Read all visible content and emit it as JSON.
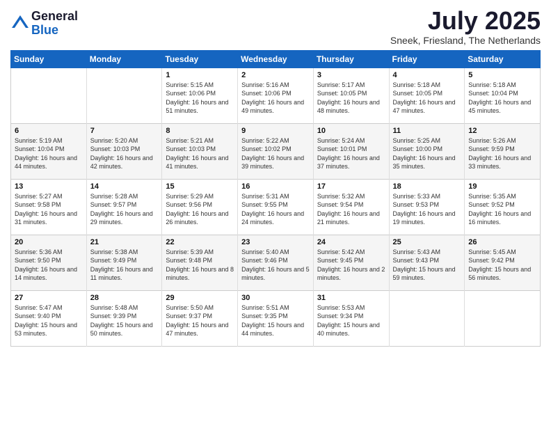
{
  "header": {
    "logo_general": "General",
    "logo_blue": "Blue",
    "month_title": "July 2025",
    "location": "Sneek, Friesland, The Netherlands"
  },
  "days_of_week": [
    "Sunday",
    "Monday",
    "Tuesday",
    "Wednesday",
    "Thursday",
    "Friday",
    "Saturday"
  ],
  "weeks": [
    [
      {
        "num": "",
        "content": ""
      },
      {
        "num": "",
        "content": ""
      },
      {
        "num": "1",
        "content": "Sunrise: 5:15 AM\nSunset: 10:06 PM\nDaylight: 16 hours and 51 minutes."
      },
      {
        "num": "2",
        "content": "Sunrise: 5:16 AM\nSunset: 10:06 PM\nDaylight: 16 hours and 49 minutes."
      },
      {
        "num": "3",
        "content": "Sunrise: 5:17 AM\nSunset: 10:05 PM\nDaylight: 16 hours and 48 minutes."
      },
      {
        "num": "4",
        "content": "Sunrise: 5:18 AM\nSunset: 10:05 PM\nDaylight: 16 hours and 47 minutes."
      },
      {
        "num": "5",
        "content": "Sunrise: 5:18 AM\nSunset: 10:04 PM\nDaylight: 16 hours and 45 minutes."
      }
    ],
    [
      {
        "num": "6",
        "content": "Sunrise: 5:19 AM\nSunset: 10:04 PM\nDaylight: 16 hours and 44 minutes."
      },
      {
        "num": "7",
        "content": "Sunrise: 5:20 AM\nSunset: 10:03 PM\nDaylight: 16 hours and 42 minutes."
      },
      {
        "num": "8",
        "content": "Sunrise: 5:21 AM\nSunset: 10:03 PM\nDaylight: 16 hours and 41 minutes."
      },
      {
        "num": "9",
        "content": "Sunrise: 5:22 AM\nSunset: 10:02 PM\nDaylight: 16 hours and 39 minutes."
      },
      {
        "num": "10",
        "content": "Sunrise: 5:24 AM\nSunset: 10:01 PM\nDaylight: 16 hours and 37 minutes."
      },
      {
        "num": "11",
        "content": "Sunrise: 5:25 AM\nSunset: 10:00 PM\nDaylight: 16 hours and 35 minutes."
      },
      {
        "num": "12",
        "content": "Sunrise: 5:26 AM\nSunset: 9:59 PM\nDaylight: 16 hours and 33 minutes."
      }
    ],
    [
      {
        "num": "13",
        "content": "Sunrise: 5:27 AM\nSunset: 9:58 PM\nDaylight: 16 hours and 31 minutes."
      },
      {
        "num": "14",
        "content": "Sunrise: 5:28 AM\nSunset: 9:57 PM\nDaylight: 16 hours and 29 minutes."
      },
      {
        "num": "15",
        "content": "Sunrise: 5:29 AM\nSunset: 9:56 PM\nDaylight: 16 hours and 26 minutes."
      },
      {
        "num": "16",
        "content": "Sunrise: 5:31 AM\nSunset: 9:55 PM\nDaylight: 16 hours and 24 minutes."
      },
      {
        "num": "17",
        "content": "Sunrise: 5:32 AM\nSunset: 9:54 PM\nDaylight: 16 hours and 21 minutes."
      },
      {
        "num": "18",
        "content": "Sunrise: 5:33 AM\nSunset: 9:53 PM\nDaylight: 16 hours and 19 minutes."
      },
      {
        "num": "19",
        "content": "Sunrise: 5:35 AM\nSunset: 9:52 PM\nDaylight: 16 hours and 16 minutes."
      }
    ],
    [
      {
        "num": "20",
        "content": "Sunrise: 5:36 AM\nSunset: 9:50 PM\nDaylight: 16 hours and 14 minutes."
      },
      {
        "num": "21",
        "content": "Sunrise: 5:38 AM\nSunset: 9:49 PM\nDaylight: 16 hours and 11 minutes."
      },
      {
        "num": "22",
        "content": "Sunrise: 5:39 AM\nSunset: 9:48 PM\nDaylight: 16 hours and 8 minutes."
      },
      {
        "num": "23",
        "content": "Sunrise: 5:40 AM\nSunset: 9:46 PM\nDaylight: 16 hours and 5 minutes."
      },
      {
        "num": "24",
        "content": "Sunrise: 5:42 AM\nSunset: 9:45 PM\nDaylight: 16 hours and 2 minutes."
      },
      {
        "num": "25",
        "content": "Sunrise: 5:43 AM\nSunset: 9:43 PM\nDaylight: 15 hours and 59 minutes."
      },
      {
        "num": "26",
        "content": "Sunrise: 5:45 AM\nSunset: 9:42 PM\nDaylight: 15 hours and 56 minutes."
      }
    ],
    [
      {
        "num": "27",
        "content": "Sunrise: 5:47 AM\nSunset: 9:40 PM\nDaylight: 15 hours and 53 minutes."
      },
      {
        "num": "28",
        "content": "Sunrise: 5:48 AM\nSunset: 9:39 PM\nDaylight: 15 hours and 50 minutes."
      },
      {
        "num": "29",
        "content": "Sunrise: 5:50 AM\nSunset: 9:37 PM\nDaylight: 15 hours and 47 minutes."
      },
      {
        "num": "30",
        "content": "Sunrise: 5:51 AM\nSunset: 9:35 PM\nDaylight: 15 hours and 44 minutes."
      },
      {
        "num": "31",
        "content": "Sunrise: 5:53 AM\nSunset: 9:34 PM\nDaylight: 15 hours and 40 minutes."
      },
      {
        "num": "",
        "content": ""
      },
      {
        "num": "",
        "content": ""
      }
    ]
  ]
}
